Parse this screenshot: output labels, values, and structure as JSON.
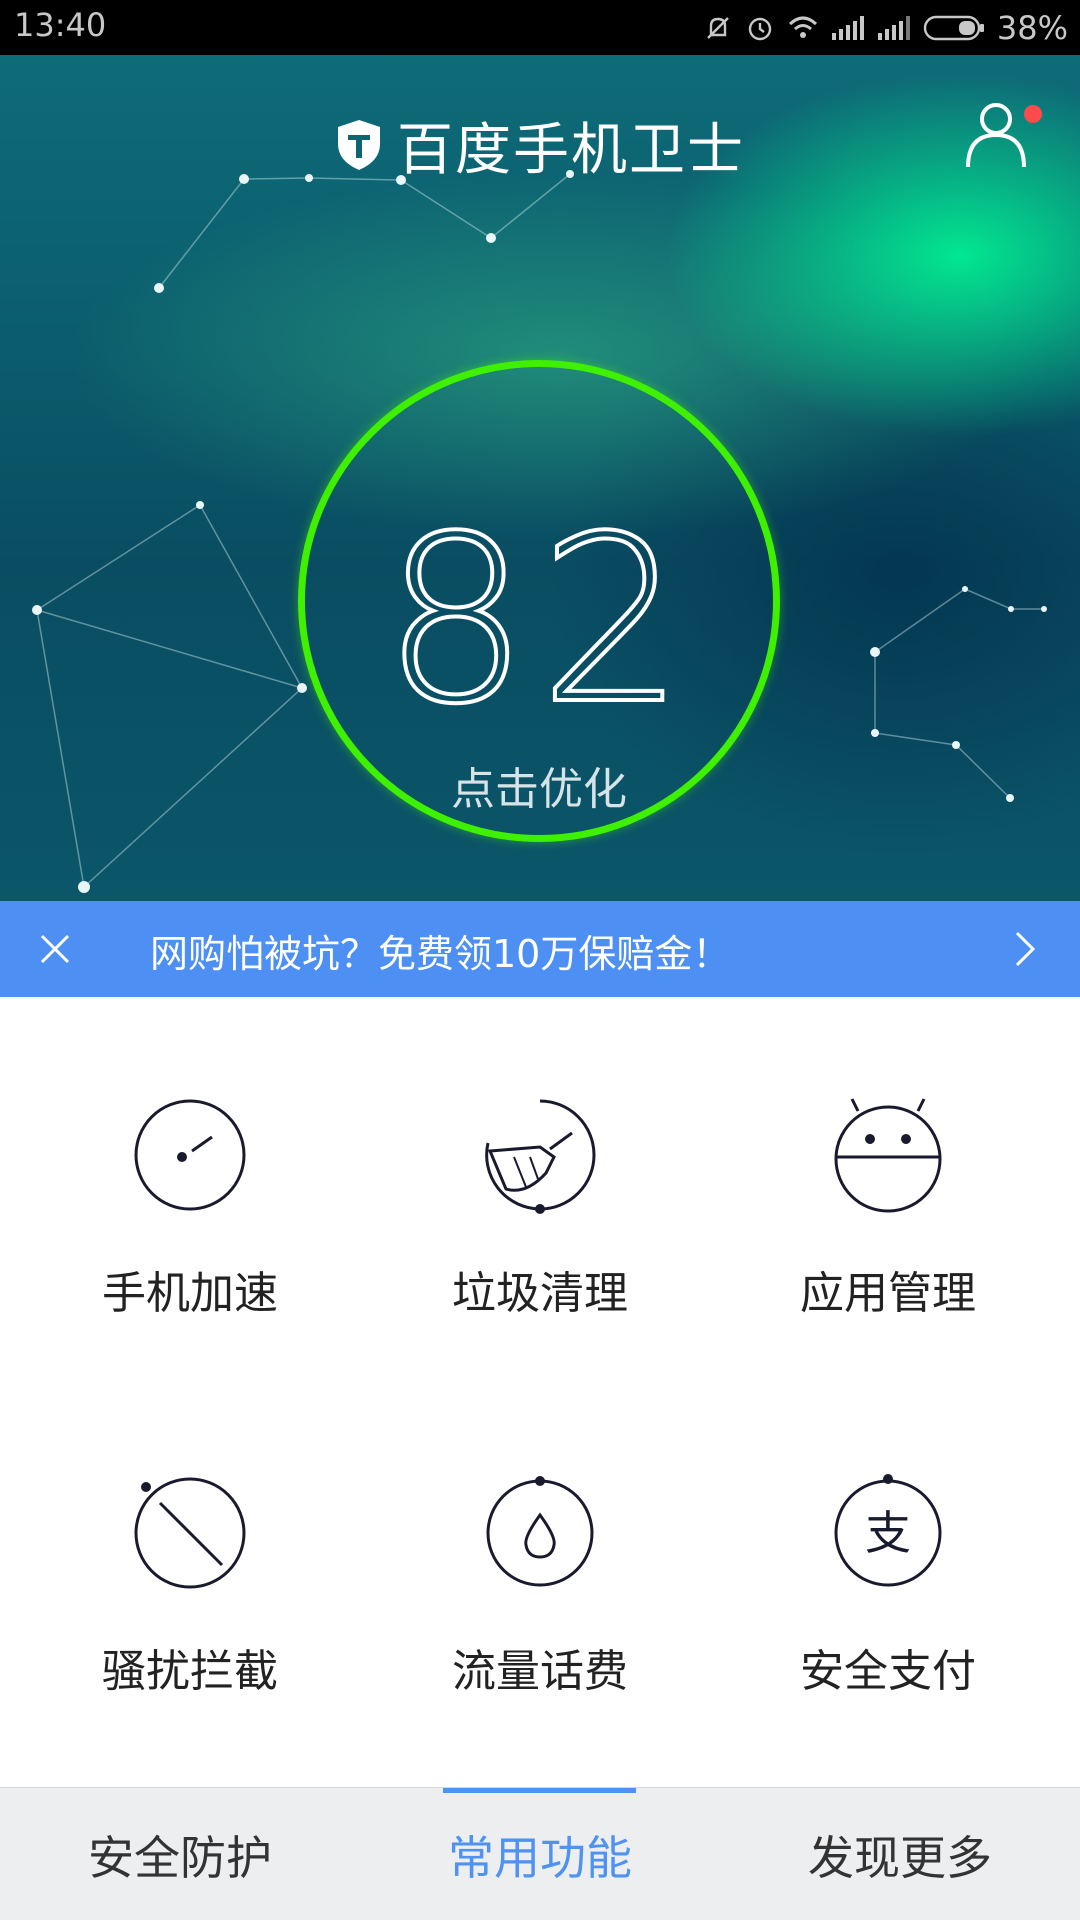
{
  "status_bar": {
    "time": "13:40",
    "battery": "38%",
    "icons": [
      "mute-icon",
      "alarm-icon",
      "wifi-icon",
      "signal-icon",
      "signal-icon",
      "battery-icon"
    ]
  },
  "header": {
    "title": "百度手机卫士",
    "logo_icon": "shield-icon",
    "user_icon": "user-icon",
    "notification_color": "#ff4b4b"
  },
  "score": {
    "value": "82",
    "action": "点击优化",
    "ring_color": "#3ff000"
  },
  "promo": {
    "text": "网购怕被坑？免费领10万保赔金！",
    "color": "#4e8ff3"
  },
  "features": [
    {
      "label": "手机加速",
      "icon": "speedometer-icon"
    },
    {
      "label": "垃圾清理",
      "icon": "broom-icon"
    },
    {
      "label": "应用管理",
      "icon": "android-icon"
    },
    {
      "label": "骚扰拦截",
      "icon": "block-icon"
    },
    {
      "label": "流量话费",
      "icon": "drop-icon"
    },
    {
      "label": "安全支付",
      "icon": "pay-icon",
      "glyph": "支"
    }
  ],
  "tabs": [
    {
      "label": "安全防护"
    },
    {
      "label": "常用功能",
      "active": true
    },
    {
      "label": "发现更多"
    }
  ],
  "accent_color": "#4f93f2"
}
